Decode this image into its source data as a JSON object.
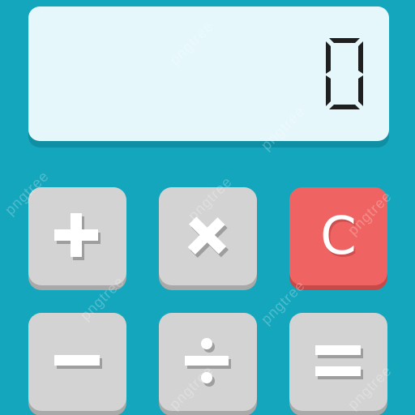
{
  "display": {
    "value": "0"
  },
  "keys": {
    "plus": {
      "symbol": "+",
      "icon": "plus-icon"
    },
    "times": {
      "symbol": "×",
      "icon": "multiply-icon"
    },
    "clear": {
      "label": "C"
    },
    "minus": {
      "symbol": "−",
      "icon": "minus-icon"
    },
    "divide": {
      "symbol": "÷",
      "icon": "divide-icon"
    },
    "equals": {
      "symbol": "=",
      "icon": "equals-icon"
    }
  },
  "watermark": {
    "text": "pngtree"
  },
  "colors": {
    "body": "#14a6bd",
    "display": "#e6f7fb",
    "key": "#d3d3d3",
    "key_shadow": "#a9a9a9",
    "clear_key": "#ef6463",
    "glyph": "#ffffff"
  }
}
